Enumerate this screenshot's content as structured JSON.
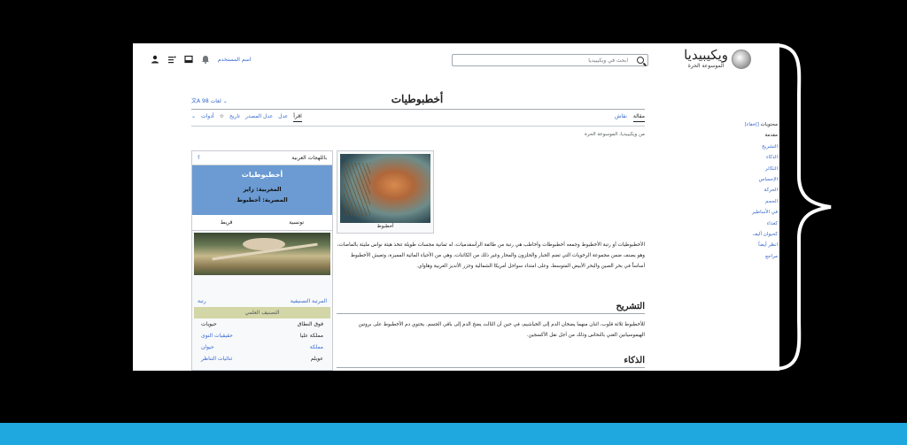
{
  "header": {
    "logo_name": "ويكيبيديا",
    "logo_tagline": "الموسوعة الحرة",
    "search_placeholder": "ابحث في ويكيبيديا",
    "username_link": "اسم المستخدم"
  },
  "toc": {
    "title": "محتويات",
    "toggle": "[إخفاء]",
    "items": [
      "مقدمة",
      "التشريح",
      "الذكاء",
      "التكاثر",
      "الإحساس",
      "الحركة",
      "الحجم",
      "في الأساطير",
      "كغذاء",
      "كحيوان أليف",
      "انظر أيضاً",
      "مراجع"
    ]
  },
  "page": {
    "title": "أخطبوطيات",
    "languages": "98 لغات",
    "tab_article": "مقالة",
    "tab_talk": "نقاش",
    "tab_read": "اقرأ",
    "tab_edit": "عدل",
    "tab_edit_source": "عدل المصدر",
    "tab_history": "تاريخ",
    "tab_tools": "أدوات",
    "from_wiki": "من ويكيبيديا، الموسوعة الحرة"
  },
  "infobox": {
    "top_label": "باللهجات العربية",
    "top_q": "؟",
    "name": "أخطبوطيات",
    "maghrebi": "المغربية: زايز",
    "egyptian": "المصرية: أخطبوط",
    "dialect_1": "تونسية",
    "dialect_2": "قريط",
    "rank_label": "المرتبة التصنيفية",
    "rank_value": "رتبة",
    "sci_class": "التصنيف العلمي",
    "rows": [
      {
        "k": "فوق النطاق",
        "v": "حيويات"
      },
      {
        "k": "مملكة عليا",
        "v": "حقيقيات النوى"
      },
      {
        "k": "مملكة",
        "v": "حيوان"
      },
      {
        "k": "عويلم",
        "v": "ثنائيات التناظر"
      }
    ]
  },
  "thumb": {
    "caption": "أخطبوط"
  },
  "content": {
    "p1": "الأخطبوطيات أو رتبة الأخطبوط وجمعه أخطبوطات وأخاطب هي رتبة من طائفة الرأسقدميات، له ثمانية مجسات طويلة تتخذ هيئة نواس مليئة بالماصات، وهو يصنف ضمن مجموعة الرخويات التي تضم الحبار والحلزون والمحار وغير ذلك من الكائنات، وهي من الأحياء المائية المميزة، وتعيش الأخطبوط أساساً في بحر الصين والبحر الأبيض المتوسط، وعلى امتداد سواحل أمريكا الشمالية وجزر الأنديز الغربية وهاواي.",
    "h_anatomy": "التشريح",
    "p2": "للأخطبوط ثلاثة قلوب، اثنان منهما يضخان الدم إلى الخياشيم، في حين أن الثالث يضخ الدم إلى باقي الجسم. يحتوي دم الأخطبوط على بروتين الهيموسيانين الغني بالنحاس وذلك من أجل نقل الأكسجين.",
    "h_intel": "الذكاء"
  }
}
